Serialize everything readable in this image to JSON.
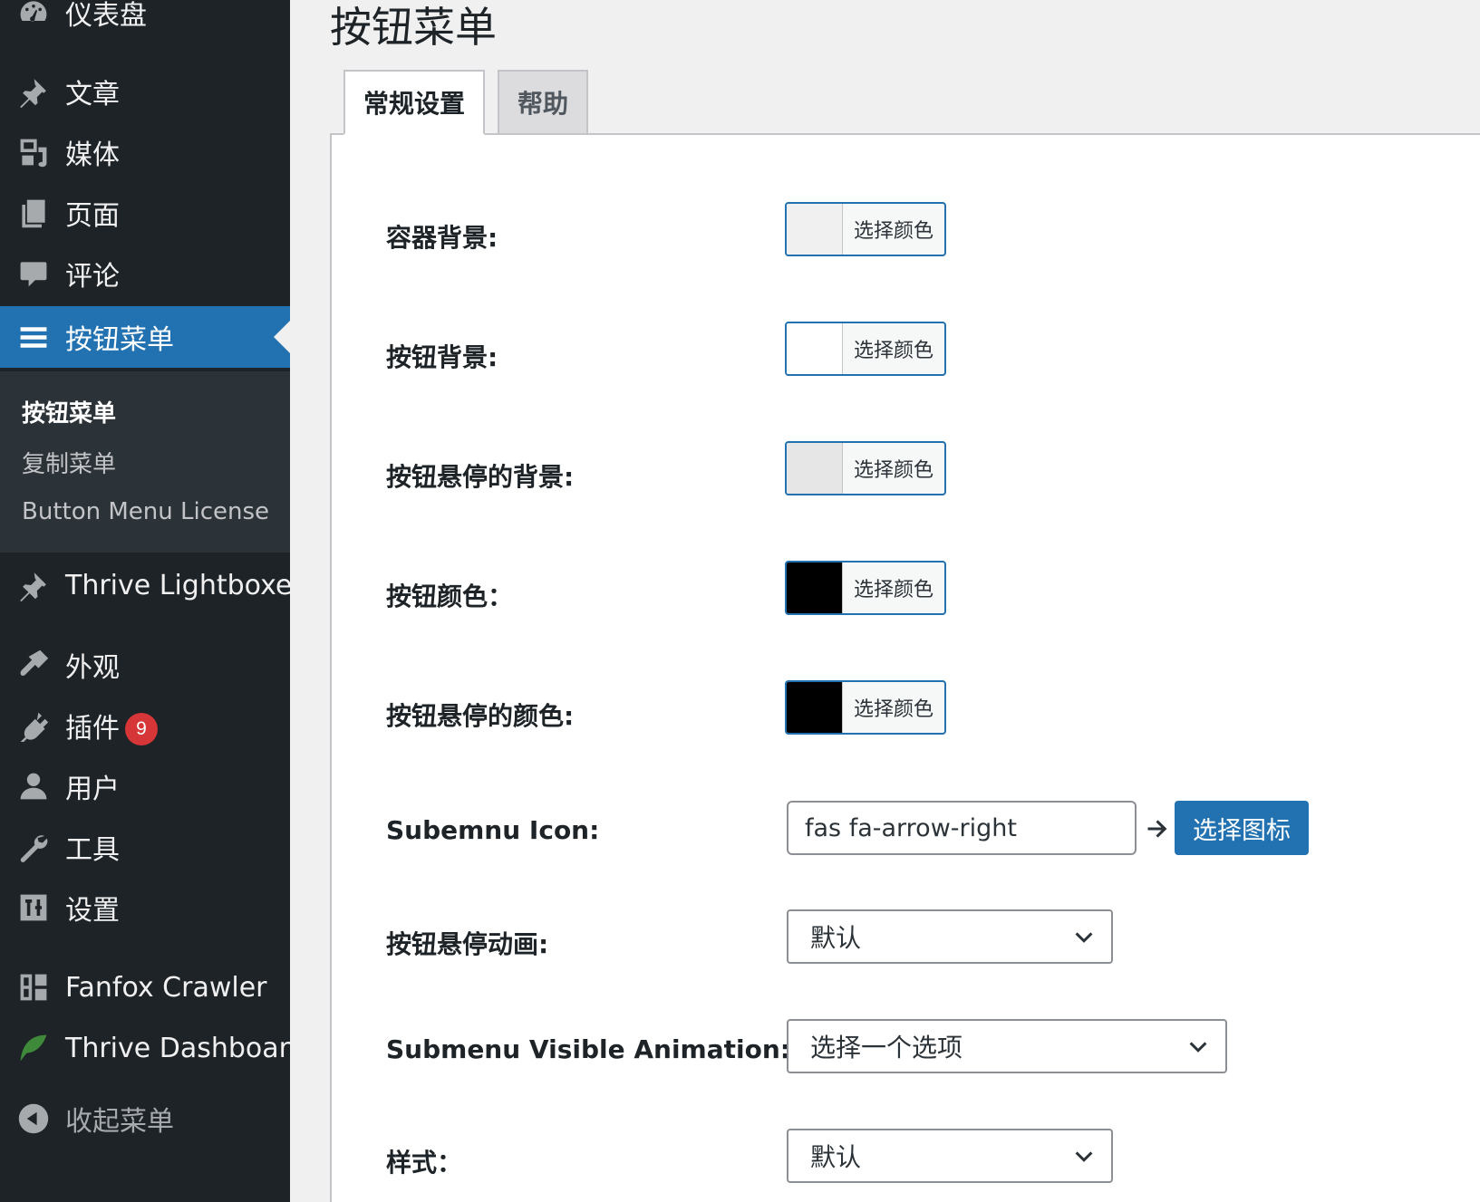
{
  "sidebar": {
    "items": [
      {
        "label": "仪表盘",
        "icon": "dashboard-icon"
      },
      {
        "label": "文章",
        "icon": "pin-icon"
      },
      {
        "label": "媒体",
        "icon": "media-icon"
      },
      {
        "label": "页面",
        "icon": "page-icon"
      },
      {
        "label": "评论",
        "icon": "comment-icon"
      },
      {
        "label": "按钮菜单",
        "icon": "menu-lines-icon"
      },
      {
        "label": "Thrive Lightboxes",
        "icon": "pin-icon"
      },
      {
        "label": "外观",
        "icon": "brush-icon"
      },
      {
        "label": "插件",
        "icon": "plugin-icon",
        "badge": "9"
      },
      {
        "label": "用户",
        "icon": "user-icon"
      },
      {
        "label": "工具",
        "icon": "wrench-icon"
      },
      {
        "label": "设置",
        "icon": "settings-icon"
      },
      {
        "label": "Fanfox Crawler",
        "icon": "grid-icon"
      },
      {
        "label": "Thrive Dashboard",
        "icon": "leaf-icon"
      },
      {
        "label": "收起菜单",
        "icon": "collapse-icon"
      }
    ],
    "submenu": [
      {
        "label": "按钮菜单"
      },
      {
        "label": "复制菜单"
      },
      {
        "label": "Button Menu License"
      }
    ]
  },
  "page": {
    "title": "按钮菜单",
    "tabs": [
      {
        "label": "常规设置"
      },
      {
        "label": "帮助"
      }
    ]
  },
  "form": {
    "color_fields": [
      {
        "label": "容器背景:",
        "button": "选择颜色",
        "color": "#f0f0f1"
      },
      {
        "label": "按钮背景:",
        "button": "选择颜色",
        "color": "#ffffff"
      },
      {
        "label": "按钮悬停的背景:",
        "button": "选择颜色",
        "color": "#e6e6e6"
      },
      {
        "label": "按钮颜色：",
        "button": "选择颜色",
        "color": "#000000"
      },
      {
        "label": "按钮悬停的颜色:",
        "button": "选择颜色",
        "color": "#000000"
      }
    ],
    "submenu_icon": {
      "label": "Subemnu Icon:",
      "value": "fas fa-arrow-right",
      "button": "选择图标"
    },
    "hover_animation": {
      "label": "按钮悬停动画:",
      "value": "默认"
    },
    "visible_animation": {
      "label": "Submenu Visible Animation:",
      "value": "选择一个选项"
    },
    "style": {
      "label": "样式：",
      "value": "默认"
    }
  }
}
